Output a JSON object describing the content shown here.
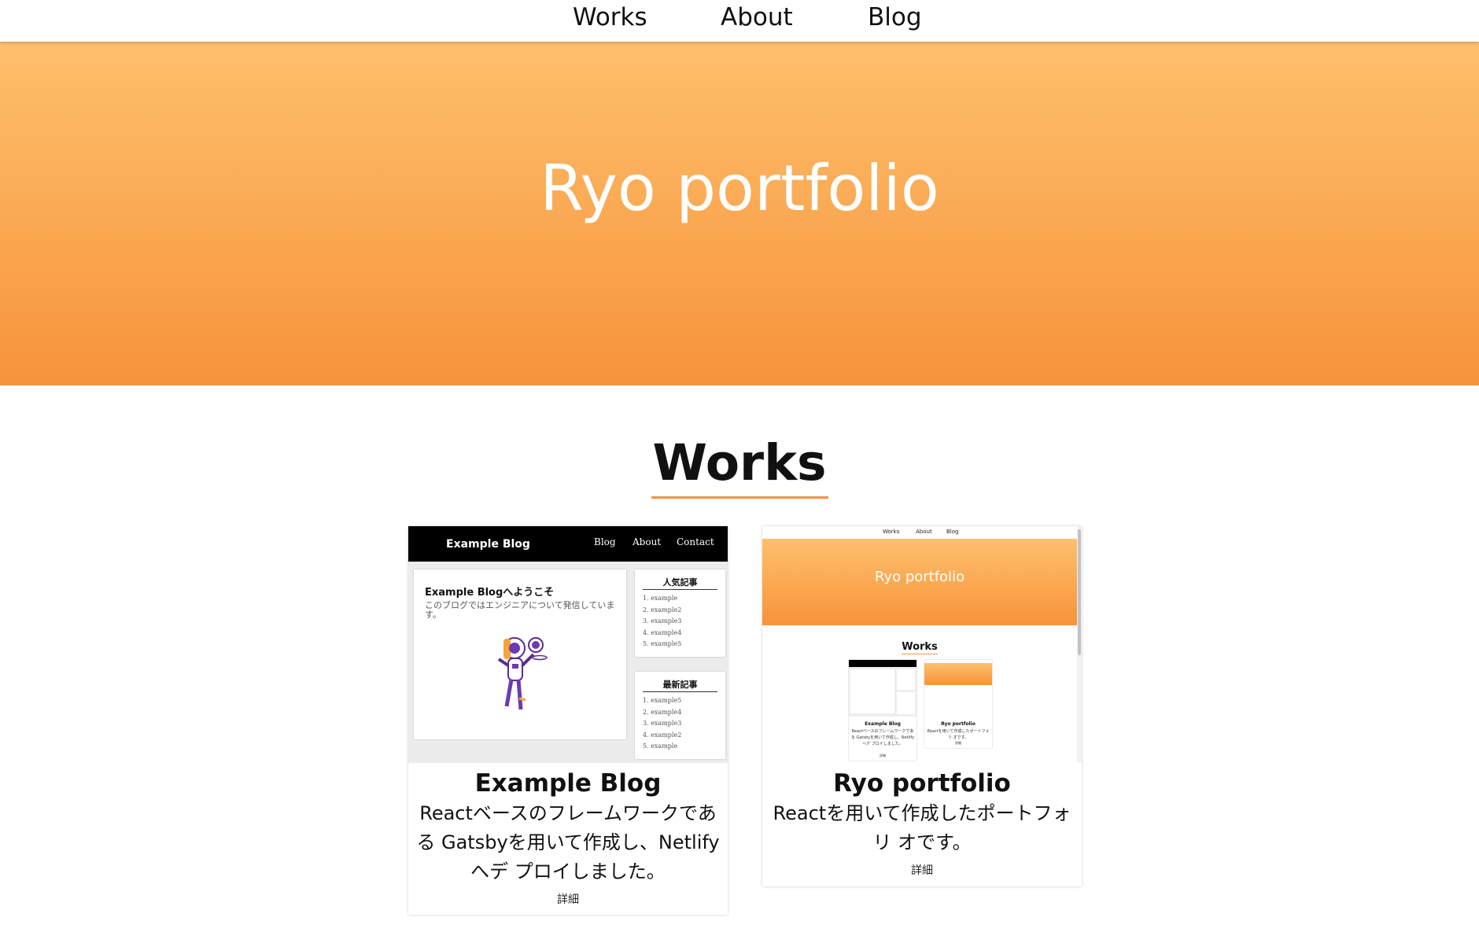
{
  "nav": {
    "items": [
      {
        "label": "Works"
      },
      {
        "label": "About"
      },
      {
        "label": "Blog"
      }
    ]
  },
  "hero": {
    "title": "Ryo portfolio"
  },
  "works": {
    "title": "Works",
    "cards": [
      {
        "title": "Example Blog",
        "description": "Reactベースのフレームワークである Gatsbyを用いて作成し、Netlifyへデ プロイしました。",
        "link_label": "詳細",
        "thumbnail": {
          "brand": "Example Blog",
          "nav": [
            "Blog",
            "About",
            "Contact"
          ],
          "main_heading": "Example Blogへようこそ",
          "main_text": "このブログではエンジニアについて発信しています。",
          "popular_heading": "人気記事",
          "popular_items": [
            "1. example",
            "2. example2",
            "3. example3",
            "4. example4",
            "5. example5"
          ],
          "latest_heading": "最新記事",
          "latest_items": [
            "1. example5",
            "2. example4",
            "3. example3",
            "4. example2",
            "5. example"
          ]
        }
      },
      {
        "title": "Ryo portfolio",
        "description": "Reactを用いて作成したポートフォリ オです。",
        "link_label": "詳細",
        "thumbnail": {
          "nav": [
            "Works",
            "About",
            "Blog"
          ],
          "hero_title": "Ryo portfolio",
          "section_title": "Works",
          "mini_cards": [
            {
              "title": "Example Blog",
              "description": "Reactベースのフレームワークである Gatsbyを用いて作成し、Netlifyへデ プロイしました。",
              "link": "詳細"
            },
            {
              "title": "Ryo portfolio",
              "description": "Reactを用いて作成したポートフォリ オです。",
              "link": "詳細"
            }
          ]
        }
      }
    ]
  },
  "colors": {
    "hero_top": "#fec06d",
    "hero_bottom": "#f7933a",
    "accent_underline": "#f19340"
  }
}
